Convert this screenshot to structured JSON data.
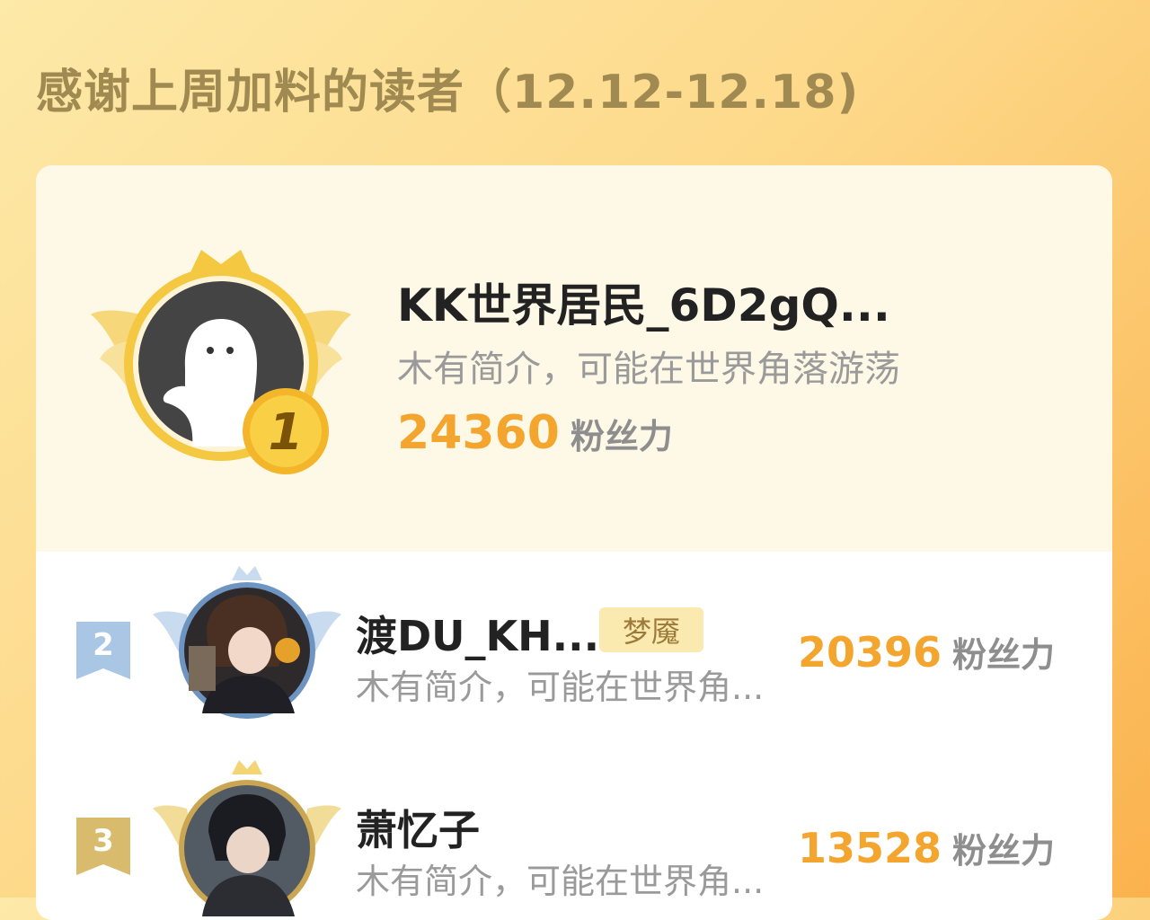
{
  "header": {
    "title": "感谢上周加料的读者（12.12-12.18)"
  },
  "readers": [
    {
      "rank": "1",
      "name": "KK世界居民_6D2gQ...",
      "bio": "木有简介，可能在世界角落游荡",
      "score": "24360",
      "unit": "粉丝力"
    },
    {
      "rank": "2",
      "name": "渡DU_KH...",
      "tag": "梦魇",
      "bio": "木有简介，可能在世界角...",
      "score": "20396",
      "unit": "粉丝力"
    },
    {
      "rank": "3",
      "name": "萧忆子",
      "bio": "木有简介，可能在世界角...",
      "score": "13528",
      "unit": "粉丝力"
    }
  ],
  "colors": {
    "score": "#f3a52d",
    "gold": "#f5c842",
    "silver": "#a9c6e4",
    "bronze": "#d8bb6c"
  }
}
